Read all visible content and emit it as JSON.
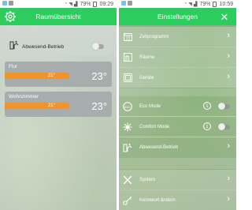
{
  "left": {
    "status": {
      "battery": "79%",
      "time": "09:29"
    },
    "title": "Raumübersicht",
    "away": {
      "label": "Abwesend-Betrieb",
      "enabled": false
    },
    "rooms": [
      {
        "name": "Flur",
        "setpoint": "21°",
        "current": "23°"
      },
      {
        "name": "Wohnzimmer",
        "setpoint": "21°",
        "current": "23°"
      }
    ]
  },
  "right": {
    "status": {
      "battery": "79%",
      "time": "10:59"
    },
    "title": "Einstellungen",
    "items": [
      {
        "label": "Zeitprogramm",
        "icon": "calendar-icon"
      },
      {
        "label": "Räume",
        "icon": "room-icon"
      },
      {
        "label": "Geräte",
        "icon": "device-icon"
      },
      {
        "label": "Eco Mode",
        "icon": "eco-icon",
        "toggle": false
      },
      {
        "label": "Comfort Mode",
        "icon": "comfort-icon",
        "toggle": false
      },
      {
        "label": "Abwesend-Betrieb",
        "icon": "away-icon"
      },
      {
        "label": "System",
        "icon": "tools-icon"
      },
      {
        "label": "Kennwort ändern",
        "icon": "key-icon"
      }
    ]
  },
  "colors": {
    "accent": "#2ccd5e",
    "setpoint": "#f0932b"
  }
}
